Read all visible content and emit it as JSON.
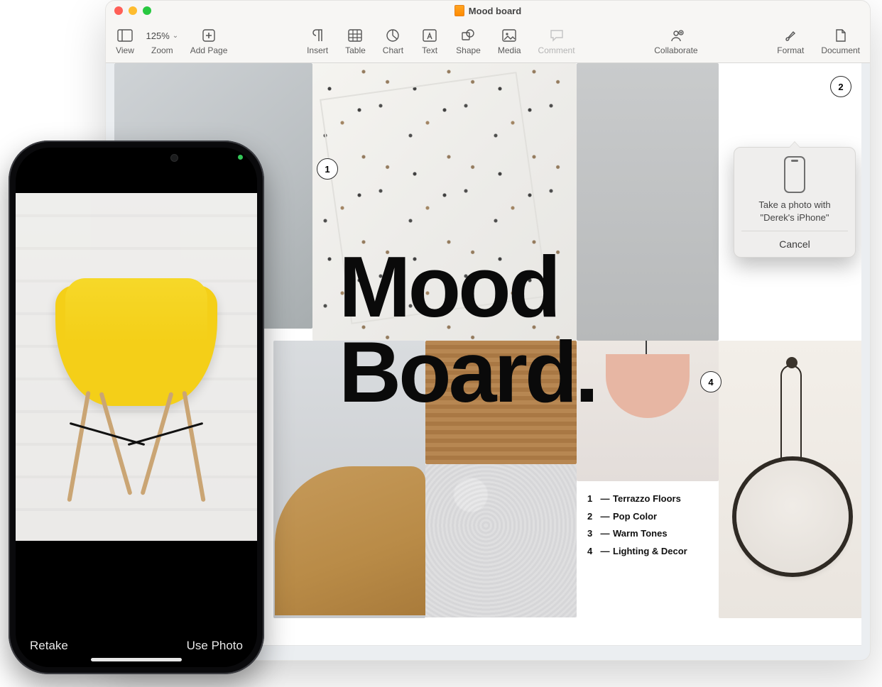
{
  "window": {
    "title": "Mood board",
    "toolbar": {
      "view": "View",
      "zoom_value": "125%",
      "zoom_label": "Zoom",
      "add_page": "Add Page",
      "insert": "Insert",
      "table": "Table",
      "chart": "Chart",
      "text": "Text",
      "shape": "Shape",
      "media": "Media",
      "comment": "Comment",
      "collaborate": "Collaborate",
      "format": "Format",
      "document": "Document"
    }
  },
  "document": {
    "headline_line1": "Mood",
    "headline_line2": "Board.",
    "callouts": {
      "c1": "1",
      "c2": "2",
      "c4": "4"
    },
    "legend": [
      {
        "num": "1",
        "label": "Terrazzo Floors"
      },
      {
        "num": "2",
        "label": "Pop Color"
      },
      {
        "num": "3",
        "label": "Warm Tones"
      },
      {
        "num": "4",
        "label": "Lighting & Decor"
      }
    ]
  },
  "popover": {
    "message_line1": "Take a photo with",
    "message_line2": "\"Derek's iPhone\"",
    "cancel": "Cancel"
  },
  "iphone": {
    "retake": "Retake",
    "use_photo": "Use Photo"
  }
}
